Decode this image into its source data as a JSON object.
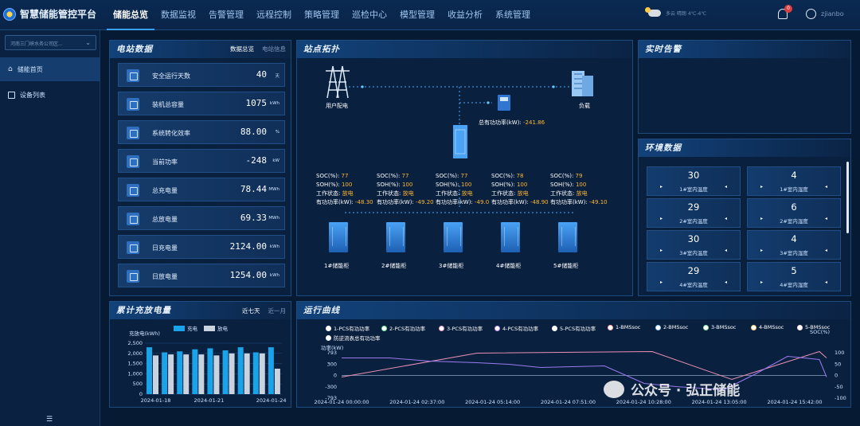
{
  "app": {
    "title": "智慧储能管控平台"
  },
  "nav": [
    "储能总览",
    "数据监视",
    "告警管理",
    "远程控制",
    "策略管理",
    "巡检中心",
    "模型管理",
    "收益分析",
    "系统管理"
  ],
  "header": {
    "weather_text": "多云 晴朗 4℃-4℃",
    "notification_count": "0",
    "username": "zjianbo"
  },
  "sidebar": {
    "station_select": "河南三门峡水务公司区...",
    "items": [
      {
        "label": "储能首页"
      },
      {
        "label": "设备列表"
      }
    ],
    "collapse_icon": "☰"
  },
  "station_data": {
    "title": "电站数据",
    "tabs": [
      "数据总览",
      "电站信息"
    ],
    "stats": [
      {
        "label": "安全运行天数",
        "value": "40",
        "unit": "天"
      },
      {
        "label": "装机总容量",
        "value": "1075",
        "unit": "kWh"
      },
      {
        "label": "系统转化效率",
        "value": "88.00",
        "unit": "%"
      },
      {
        "label": "当前功率",
        "value": "-248",
        "unit": "kW"
      },
      {
        "label": "总充电量",
        "value": "78.44",
        "unit": "MWh"
      },
      {
        "label": "总放电量",
        "value": "69.33",
        "unit": "MWh"
      },
      {
        "label": "日充电量",
        "value": "2124.00",
        "unit": "kWh"
      },
      {
        "label": "日放电量",
        "value": "1254.00",
        "unit": "kWh"
      }
    ]
  },
  "topology": {
    "title": "站点拓扑",
    "grid_label": "用户配电",
    "load_label": "负载",
    "total_power_label": "总有功功率(kW):",
    "total_power_value": "-241.86",
    "soc_label": "SOC(%):",
    "soh_label": "SOH(%):",
    "status_label": "工作状态:",
    "power_label": "有功功率(kW):",
    "pcs": [
      {
        "soc": "77",
        "soh": "100",
        "status": "放电",
        "power": "-48.30",
        "cabinet": "1#储能柜"
      },
      {
        "soc": "77",
        "soh": "100",
        "status": "放电",
        "power": "-49.20",
        "cabinet": "2#储能柜"
      },
      {
        "soc": "77",
        "soh": "100",
        "status": "放电",
        "power": "-49.0",
        "cabinet": "3#储能柜"
      },
      {
        "soc": "78",
        "soh": "100",
        "status": "放电",
        "power": "-48.90",
        "cabinet": "4#储能柜"
      },
      {
        "soc": "79",
        "soh": "100",
        "status": "放电",
        "power": "-49.10",
        "cabinet": "5#储能柜"
      }
    ]
  },
  "alarms": {
    "title": "实时告警"
  },
  "environment": {
    "title": "环境数据",
    "items": [
      {
        "value": "30",
        "label": "1#室内温度"
      },
      {
        "value": "4",
        "label": "1#室内湿度"
      },
      {
        "value": "29",
        "label": "2#室内温度"
      },
      {
        "value": "6",
        "label": "2#室内湿度"
      },
      {
        "value": "30",
        "label": "3#室内温度"
      },
      {
        "value": "4",
        "label": "3#室内湿度"
      },
      {
        "value": "29",
        "label": "4#室内温度"
      },
      {
        "value": "5",
        "label": "4#室内湿度"
      }
    ]
  },
  "charge_chart": {
    "title": "累计充放电量",
    "tabs": [
      "近七天",
      "近一月"
    ],
    "chart_data": {
      "type": "bar",
      "ylabel": "充放电(kWh)",
      "ylim": [
        0,
        2500
      ],
      "yticks": [
        "2,500",
        "2,000",
        "1,500",
        "1,000",
        "500",
        "0"
      ],
      "categories": [
        "2024-01-18",
        "",
        "2024-01-21",
        "",
        "2024-01-24"
      ],
      "xticks": [
        "2024-01-18",
        "2024-01-21",
        "2024-01-24"
      ],
      "series": [
        {
          "name": "充电",
          "color": "#1aa3e8",
          "values": [
            2300,
            2050,
            2100,
            2200,
            2250,
            2150,
            2300,
            2050,
            2300
          ]
        },
        {
          "name": "放电",
          "color": "#c9d3e0",
          "values": [
            1900,
            1950,
            1950,
            1950,
            1900,
            2000,
            2000,
            2000,
            1250
          ]
        }
      ]
    }
  },
  "run_chart": {
    "title": "运行曲线",
    "legend": [
      "1-PCS有功功率",
      "2-PCS有功功率",
      "3-PCS有功功率",
      "4-PCS有功功率",
      "5-PCS有功功率",
      "1-BMSsoc",
      "2-BMSsoc",
      "3-BMSsoc",
      "4-BMSsoc",
      "5-BMSsoc",
      "防逆流表总有功功率"
    ],
    "legend_colors": [
      "#ffffff",
      "#7cf0a8",
      "#f5a0c8",
      "#c9a0ff",
      "#ffffff",
      "#ffb0b0",
      "#a0d0ff",
      "#8fe8b0",
      "#ffd080",
      "#ffe0e0",
      "#ffffff"
    ],
    "chart_data": {
      "type": "line",
      "ylabel_left": "功率(kW)",
      "ylabel_right": "SOC(%)",
      "yticks_left": [
        "793",
        "300",
        "0",
        "-300",
        "-793"
      ],
      "yticks_right": [
        "100",
        "50",
        "0",
        "-50",
        "-100"
      ],
      "xticks": [
        "2024-01-24 00:00:00",
        "2024-01-24 02:37:00",
        "2024-01-24 05:14:00",
        "2024-01-24 07:51:00",
        "2024-01-24 10:28:00",
        "2024-01-24 13:05:00",
        "2024-01-24 15:42:00"
      ]
    }
  },
  "watermark": {
    "text": "公众号 · 弘正储能"
  }
}
